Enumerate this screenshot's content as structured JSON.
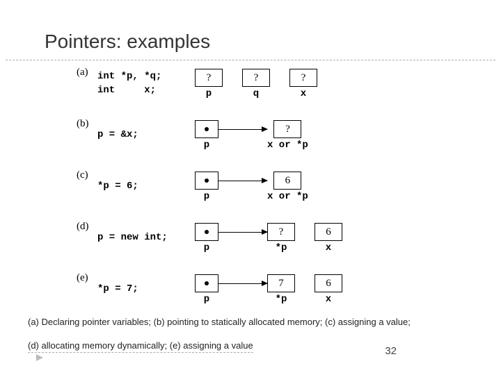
{
  "title": "Pointers: examples",
  "rows": [
    {
      "letter": "(a)",
      "code": "int *p, *q;\nint     x;",
      "cells": [
        {
          "type": "box",
          "val": "?",
          "label": "p"
        },
        {
          "type": "box",
          "val": "?",
          "label": "q"
        },
        {
          "type": "box",
          "val": "?",
          "label": "x"
        }
      ]
    },
    {
      "letter": "(b)",
      "code": "p = &x;",
      "cells": [
        {
          "type": "dotbox",
          "label": "p"
        },
        {
          "type": "arrow"
        },
        {
          "type": "box",
          "val": "?",
          "label": "x or *p"
        }
      ]
    },
    {
      "letter": "(c)",
      "code": "*p = 6;",
      "cells": [
        {
          "type": "dotbox",
          "label": "p"
        },
        {
          "type": "arrow"
        },
        {
          "type": "box",
          "val": "6",
          "label": "x or *p"
        }
      ]
    },
    {
      "letter": "(d)",
      "code": "p = new int;",
      "cells": [
        {
          "type": "dotbox",
          "label": "p"
        },
        {
          "type": "arrow"
        },
        {
          "type": "box",
          "val": "?",
          "label": "*p"
        },
        {
          "type": "box",
          "val": "6",
          "label": "x"
        }
      ]
    },
    {
      "letter": "(e)",
      "code": "*p = 7;",
      "cells": [
        {
          "type": "dotbox",
          "label": "p"
        },
        {
          "type": "arrow"
        },
        {
          "type": "box",
          "val": "7",
          "label": "*p"
        },
        {
          "type": "box",
          "val": "6",
          "label": "x"
        }
      ]
    }
  ],
  "caption1": "(a) Declaring pointer variables; (b) pointing to statically allocated memory; (c) assigning a value;",
  "caption2": "(d) allocating memory dynamically; (e) assigning a value",
  "pagenum": "32"
}
